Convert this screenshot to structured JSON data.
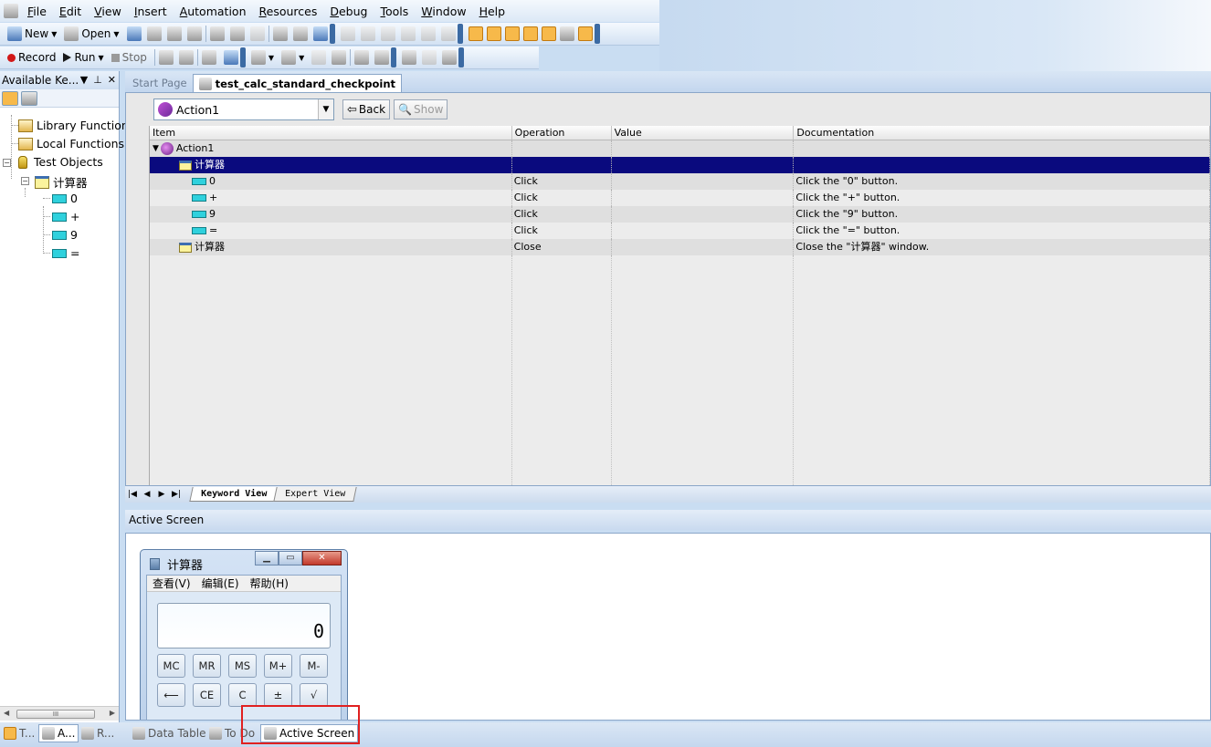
{
  "menubar": {
    "items": [
      "File",
      "Edit",
      "View",
      "Insert",
      "Automation",
      "Resources",
      "Debug",
      "Tools",
      "Window",
      "Help"
    ]
  },
  "toolbar": {
    "new_label": "New",
    "open_label": "Open",
    "record_label": "Record",
    "run_label": "Run",
    "stop_label": "Stop"
  },
  "left_pane": {
    "title": "Available Ke...",
    "tree": [
      {
        "label": "Library Functions",
        "icon": "library-icon"
      },
      {
        "label": "Local Functions",
        "icon": "library-icon"
      },
      {
        "label": "Test Objects",
        "icon": "database-icon"
      },
      {
        "label": "计算器",
        "icon": "window-icon"
      },
      {
        "label": "0",
        "icon": "button-icon"
      },
      {
        "label": "+",
        "icon": "button-icon"
      },
      {
        "label": "9",
        "icon": "button-icon"
      },
      {
        "label": "=",
        "icon": "button-icon"
      }
    ],
    "scroll_glyph": "III"
  },
  "doc_tabs": [
    "Start Page",
    "test_calc_standard_checkpoint"
  ],
  "action_selector": {
    "value": "Action1"
  },
  "nav": {
    "back_label": "Back",
    "show_label": "Show"
  },
  "grid": {
    "columns": [
      "Item",
      "Operation",
      "Value",
      "Documentation"
    ],
    "rows": [
      {
        "item": "Action1",
        "op": "",
        "val": "",
        "doc": ""
      },
      {
        "item": "计算器",
        "op": "",
        "val": "",
        "doc": ""
      },
      {
        "item": "0",
        "op": "Click",
        "val": "",
        "doc": "Click the \"0\" button."
      },
      {
        "item": "+",
        "op": "Click",
        "val": "",
        "doc": "Click the \"+\" button."
      },
      {
        "item": "9",
        "op": "Click",
        "val": "",
        "doc": "Click the \"9\" button."
      },
      {
        "item": "=",
        "op": "Click",
        "val": "",
        "doc": "Click the \"=\" button."
      },
      {
        "item": "计算器",
        "op": "Close",
        "val": "",
        "doc": "Close the \"计算器\" window."
      }
    ]
  },
  "view_tabs": [
    "Keyword View",
    "Expert View"
  ],
  "active_screen": {
    "title": "Active Screen",
    "calc": {
      "title": "计算器",
      "menu": [
        "查看(V)",
        "编辑(E)",
        "帮助(H)"
      ],
      "display": "0",
      "keys": [
        "MC",
        "MR",
        "MS",
        "M+",
        "M-",
        "⟵",
        "CE",
        "C",
        "±",
        "√"
      ]
    }
  },
  "bottom_tabs_left": [
    "T...",
    "A...",
    "R..."
  ],
  "bottom_tabs": [
    "Data Table",
    "To Do",
    "Active Screen"
  ],
  "colors": {
    "selection": "#0a0a7e",
    "highlight_box": "#e02020"
  }
}
